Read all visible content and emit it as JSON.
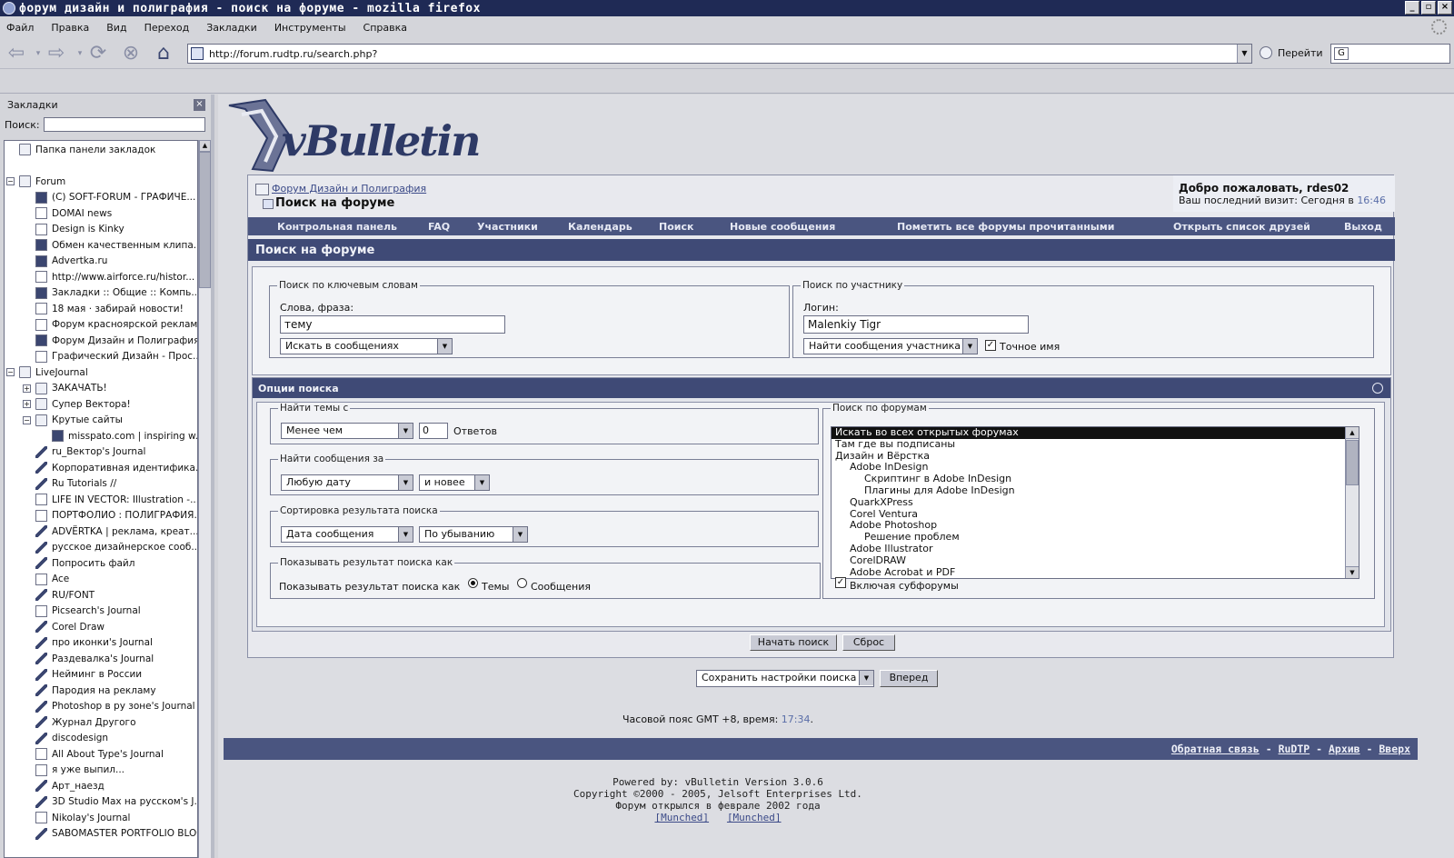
{
  "window": {
    "title": "форум дизайн и полиграфия - поиск на форуме - mozilla firefox"
  },
  "menubar": [
    "Файл",
    "Правка",
    "Вид",
    "Переход",
    "Закладки",
    "Инструменты",
    "Справка"
  ],
  "navbar": {
    "url": "http://forum.rudtp.ru/search.php?",
    "go_label": "Перейти"
  },
  "sidebar": {
    "title": "Закладки",
    "search_label": "Поиск:",
    "items": [
      {
        "text": "Папка панели закладок",
        "level": 0,
        "icon": "folder-icon"
      },
      {
        "text": "Forum",
        "level": 0,
        "icon": "folder-icon",
        "toggle": "−"
      },
      {
        "text": "(C) SOFT-FORUM - ГРАФИЧЕ...",
        "level": 1,
        "icon": "site-icon"
      },
      {
        "text": "DOMAI news",
        "level": 1,
        "icon": "page-icon"
      },
      {
        "text": "Design is Kinky",
        "level": 1,
        "icon": "page-icon"
      },
      {
        "text": "Обмен качественным клипа...",
        "level": 1,
        "icon": "ru-icon"
      },
      {
        "text": "Advertka.ru",
        "level": 1,
        "icon": "site-icon"
      },
      {
        "text": "http://www.airforce.ru/histor...",
        "level": 1,
        "icon": "page-icon"
      },
      {
        "text": "Закладки :: Общие :: Компь...",
        "level": 1,
        "icon": "ru-icon"
      },
      {
        "text": "18 мая · забирай новости!",
        "level": 1,
        "icon": "page-icon"
      },
      {
        "text": "Форум красноярской реклам...",
        "level": 1,
        "icon": "page-icon"
      },
      {
        "text": "Форум Дизайн и Полиграфия...",
        "level": 1,
        "icon": "site-icon"
      },
      {
        "text": "Графический Дизайн - Прос...",
        "level": 1,
        "icon": "page-icon"
      },
      {
        "text": "LiveJournal",
        "level": 0,
        "icon": "folder-icon",
        "toggle": "−"
      },
      {
        "text": "ЗАКАЧАТЬ!",
        "level": 1,
        "icon": "folder-icon",
        "toggle": "+"
      },
      {
        "text": "Супер Вектора!",
        "level": 1,
        "icon": "folder-icon",
        "toggle": "+"
      },
      {
        "text": "Крутые сайты",
        "level": 1,
        "icon": "folder-icon",
        "toggle": "−"
      },
      {
        "text": "misspato.com | inspiring w...",
        "level": 2,
        "icon": "site-icon"
      },
      {
        "text": "ru_Вектор's Journal",
        "level": 1,
        "icon": "lj-icon"
      },
      {
        "text": "Корпоративная идентифика...",
        "level": 1,
        "icon": "lj-icon"
      },
      {
        "text": "Ru Tutorials //",
        "level": 1,
        "icon": "lj-icon"
      },
      {
        "text": "LIFE IN VECTOR: Illustration -...",
        "level": 1,
        "icon": "page-icon"
      },
      {
        "text": "ПОРТФОЛИО : ПОЛИГРАФИЯ...",
        "level": 1,
        "icon": "page-icon"
      },
      {
        "text": "ADVЁRTKA | реклама, креат...",
        "level": 1,
        "icon": "lj-icon"
      },
      {
        "text": "русское дизайнерское сооб...",
        "level": 1,
        "icon": "lj-icon"
      },
      {
        "text": "Попросить файл",
        "level": 1,
        "icon": "lj-icon"
      },
      {
        "text": "Ace",
        "level": 1,
        "icon": "page-icon"
      },
      {
        "text": "RU/FONT",
        "level": 1,
        "icon": "lj-icon"
      },
      {
        "text": "Picsearch's Journal",
        "level": 1,
        "icon": "page-icon"
      },
      {
        "text": "Corel Draw",
        "level": 1,
        "icon": "lj-icon"
      },
      {
        "text": "про иконки's Journal",
        "level": 1,
        "icon": "lj-icon"
      },
      {
        "text": "Раздевалка's Journal",
        "level": 1,
        "icon": "lj-icon"
      },
      {
        "text": "Нейминг в России",
        "level": 1,
        "icon": "lj-icon"
      },
      {
        "text": "Пародия на рекламу",
        "level": 1,
        "icon": "lj-icon"
      },
      {
        "text": "Photoshop в ру зоне's Journal",
        "level": 1,
        "icon": "lj-icon"
      },
      {
        "text": "Журнал Другого",
        "level": 1,
        "icon": "lj-icon"
      },
      {
        "text": "discodesign",
        "level": 1,
        "icon": "lj-icon"
      },
      {
        "text": "All About Type's Journal",
        "level": 1,
        "icon": "page-icon"
      },
      {
        "text": "я уже выпил...",
        "level": 1,
        "icon": "page-icon"
      },
      {
        "text": "Арт_наезд",
        "level": 1,
        "icon": "lj-icon"
      },
      {
        "text": "3D Studio Max на русском's J...",
        "level": 1,
        "icon": "lj-icon"
      },
      {
        "text": "Nikolay's Journal",
        "level": 1,
        "icon": "page-icon"
      },
      {
        "text": "SABOMASTER PORTFOLIO BLOG",
        "level": 1,
        "icon": "lj-icon"
      }
    ]
  },
  "page": {
    "breadcrumb_link": "Форум Дизайн и Полиграфия",
    "breadcrumb_current": "Поиск на форуме",
    "welcome": "Добро пожаловать, rdes02",
    "last_visit_prefix": "Ваш последний визит: Сегодня в ",
    "last_visit_time": "16:46",
    "nav": [
      "Контрольная панель",
      "FAQ",
      "Участники",
      "Календарь",
      "Поиск",
      "Новые сообщения",
      "Пометить все форумы прочитанными",
      "Открыть список друзей",
      "Выход"
    ],
    "search_title": "Поиск на форуме",
    "keywords": {
      "legend": "Поиск по ключевым словам",
      "label": "Слова, фраза:",
      "value": "тему",
      "where": "Искать в сообщениях"
    },
    "user": {
      "legend": "Поиск по участнику",
      "label": "Логин:",
      "value": "Malenkiy Tigr",
      "mode": "Найти сообщения участника",
      "exact_label": "Точное имя",
      "exact_checked": true
    },
    "options_title": "Опции поиска",
    "threads": {
      "legend": "Найти темы с",
      "mode": "Менее чем",
      "count": "0",
      "suffix": "Ответов"
    },
    "posts": {
      "legend": "Найти сообщения за",
      "period": "Любую дату",
      "direction": "и новее"
    },
    "sort": {
      "legend": "Сортировка результата поиска",
      "field": "Дата сообщения",
      "order": "По убыванию"
    },
    "show": {
      "legend": "Показывать результат поиска как",
      "label": "Показывать результат поиска как",
      "opt1": "Темы",
      "opt2": "Сообщения",
      "selected": "Темы"
    },
    "forums": {
      "legend": "Поиск по форумам",
      "options": [
        {
          "text": "Искать во всех открытых форумах",
          "level": 0,
          "selected": true
        },
        {
          "text": "Там где вы подписаны",
          "level": 0
        },
        {
          "text": "Дизайн и Вёрстка",
          "level": 0
        },
        {
          "text": "Adobe InDesign",
          "level": 1
        },
        {
          "text": "Скриптинг в Adobe InDesign",
          "level": 2
        },
        {
          "text": "Плагины для Adobe InDesign",
          "level": 2
        },
        {
          "text": "QuarkXPress",
          "level": 1
        },
        {
          "text": "Corel Ventura",
          "level": 1
        },
        {
          "text": "Adobe Photoshop",
          "level": 1
        },
        {
          "text": "Решение проблем",
          "level": 2
        },
        {
          "text": "Adobe Illustrator",
          "level": 1
        },
        {
          "text": "CorelDRAW",
          "level": 1
        },
        {
          "text": "Adobe Acrobat и PDF",
          "level": 1
        }
      ],
      "subforums_label": "Включая субфорумы",
      "subforums_checked": true
    },
    "start_button": "Начать поиск",
    "reset_button": "Сброс",
    "save_select": "Сохранить настройки поиска",
    "forward_button": "Вперед",
    "timezone_prefix": "Часовой пояс GMT +8, время: ",
    "timezone_time": "17:34",
    "footer_links": [
      "Обратная связь",
      "RuDTP",
      "Архив",
      "Вверх"
    ],
    "powered": "Powered by: vBulletin Version 3.0.6",
    "copyright": "Copyright ©2000 - 2005, Jelsoft Enterprises Ltd.",
    "opened": "Форум открылся в феврале 2002 года",
    "munched": "[Munched]"
  },
  "logo_text": "vBulletin"
}
